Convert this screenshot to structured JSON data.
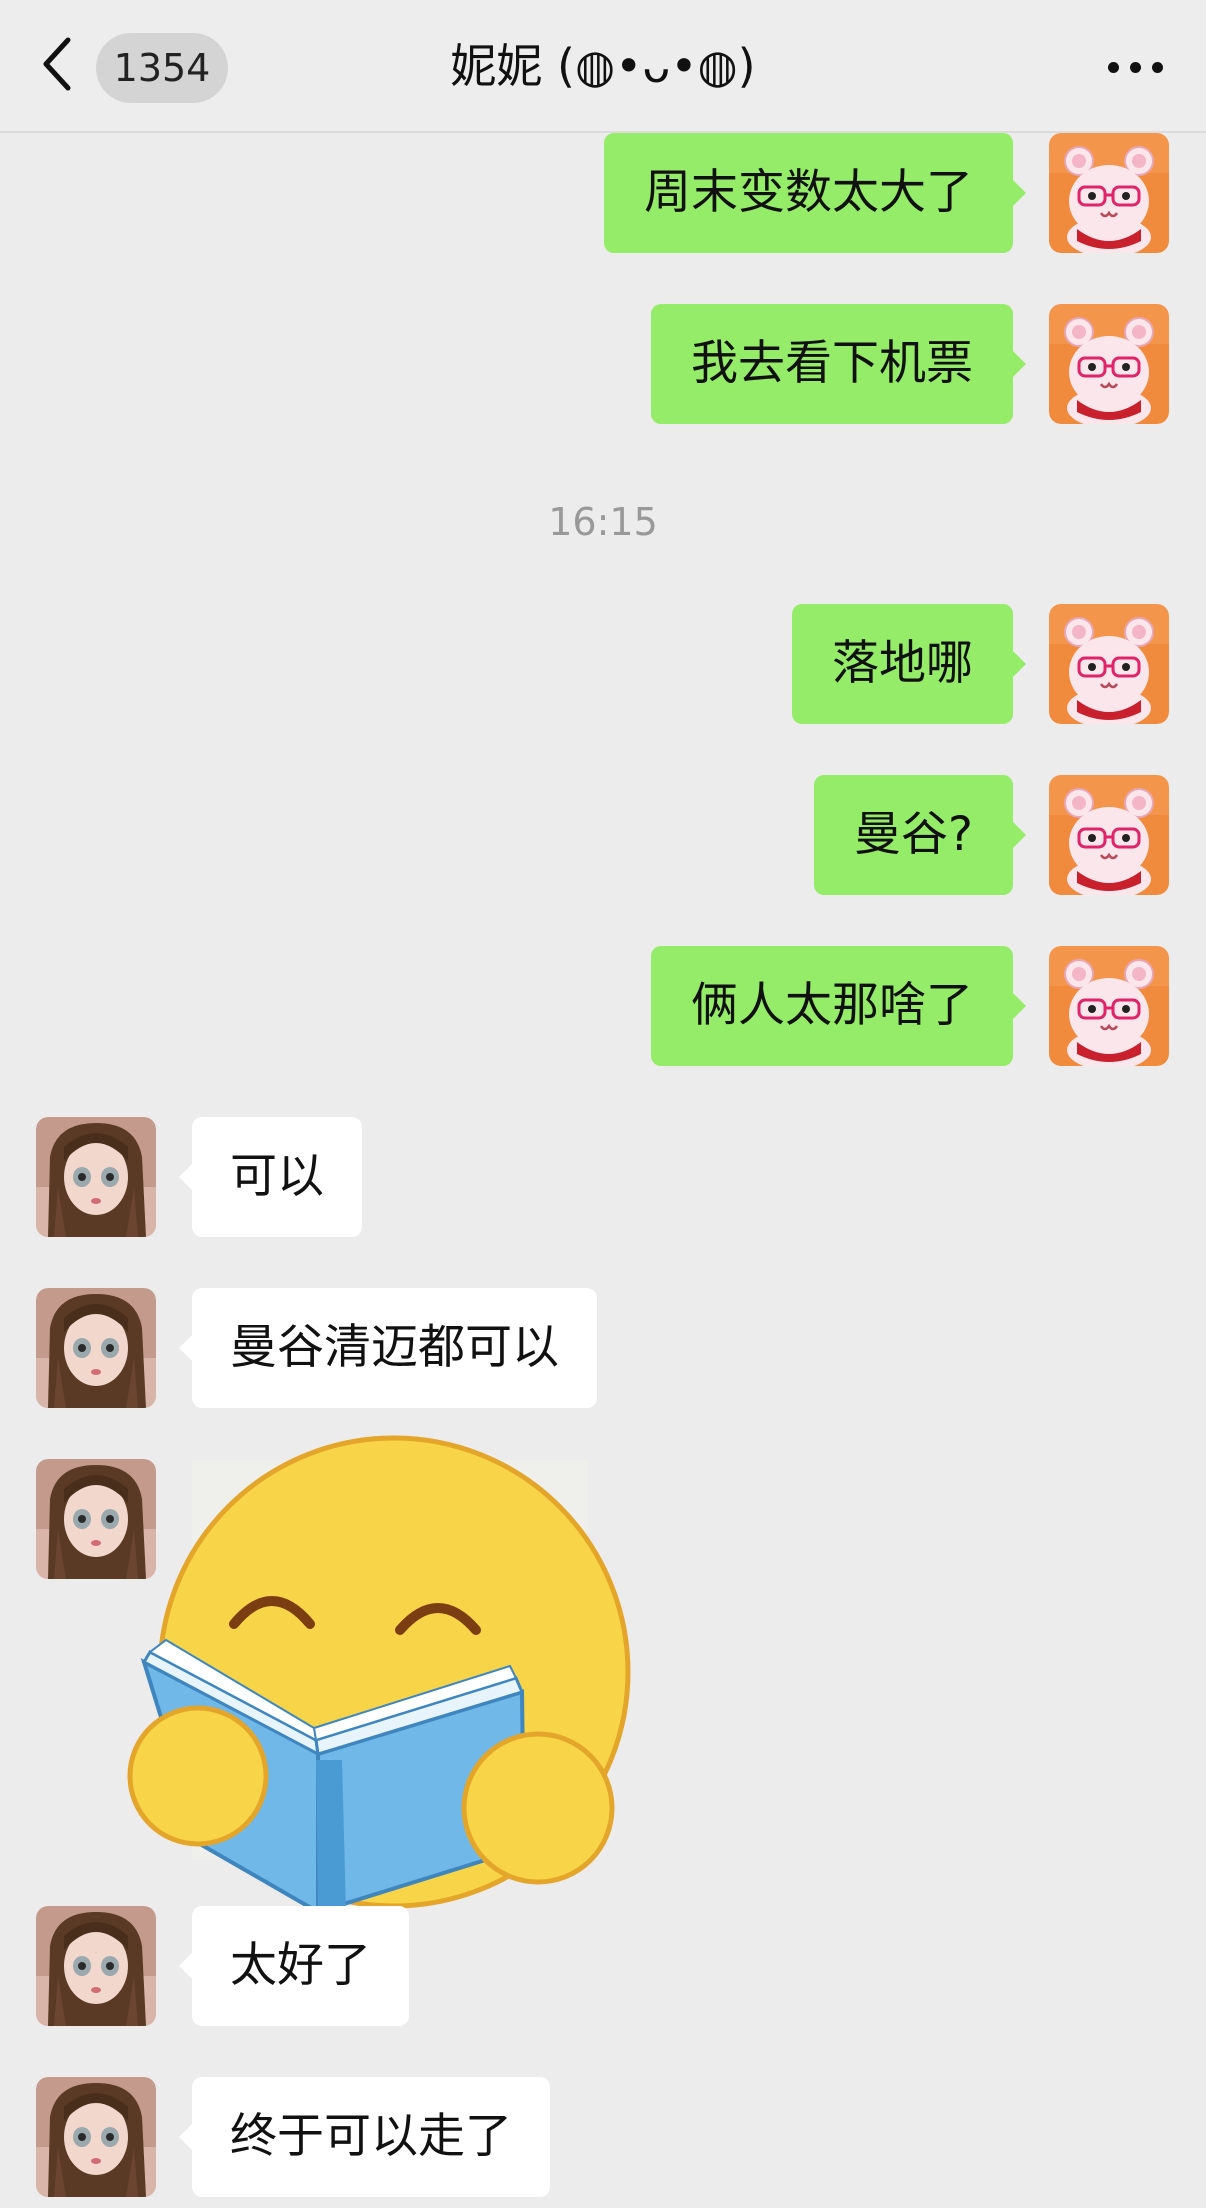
{
  "header": {
    "back_icon": "chevron-left-icon",
    "unread_count": "1354",
    "title": "妮妮 (◍•ᴗ•◍)",
    "more_icon": "more-dots-icon"
  },
  "colors": {
    "outgoing_bubble": "#95ec69",
    "incoming_bubble": "#ffffff",
    "background": "#ececec"
  },
  "timestamp": "16:15",
  "messages_out": [
    {
      "text": "周末变数太大了"
    },
    {
      "text": "我去看下机票"
    },
    {
      "text": "落地哪"
    },
    {
      "text": "曼谷?"
    },
    {
      "text": "俩人太那啥了"
    }
  ],
  "messages_in": [
    {
      "text": "可以"
    },
    {
      "text": "曼谷清迈都可以"
    },
    {
      "text": "太好了"
    },
    {
      "text": "终于可以走了"
    }
  ],
  "sticker": {
    "icon": "reading-smiley-sticker-icon"
  }
}
